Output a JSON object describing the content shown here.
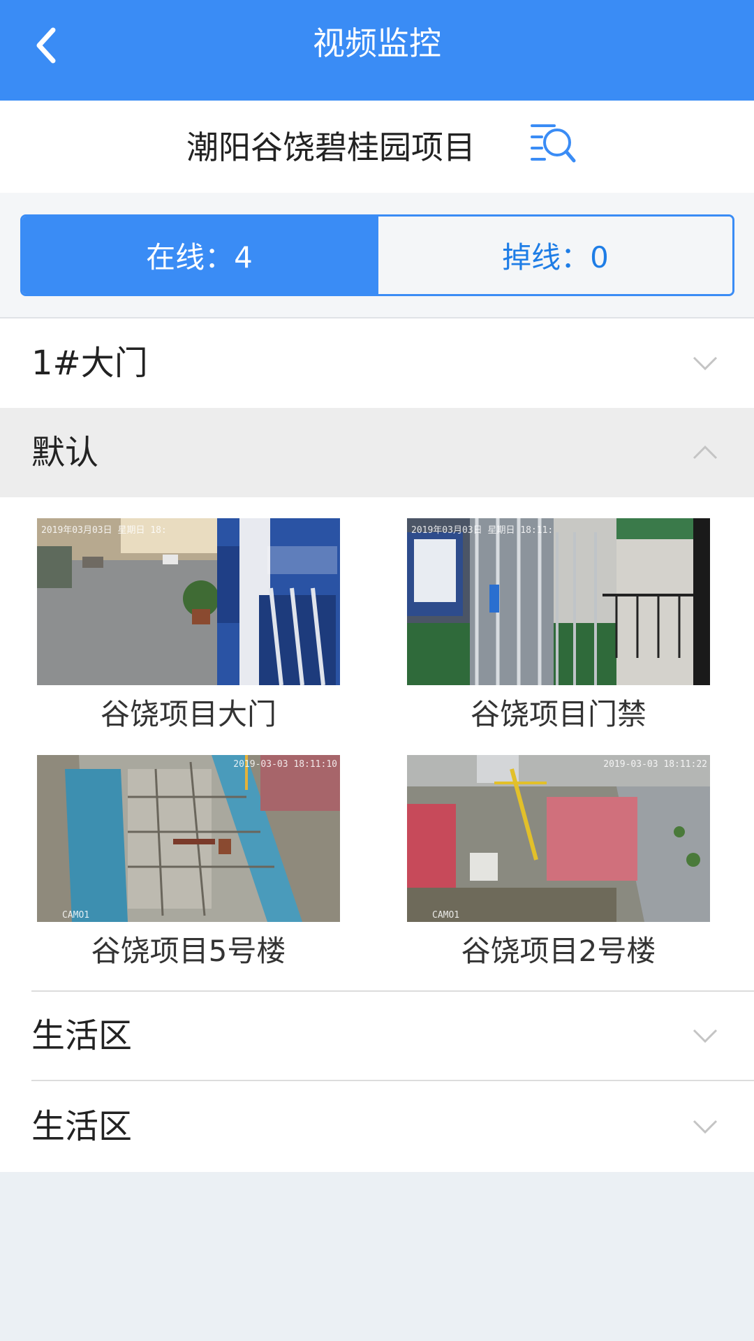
{
  "header": {
    "title": "视频监控"
  },
  "project": {
    "name": "潮阳谷饶碧桂园项目"
  },
  "status": {
    "online_label": "在线：4",
    "offline_label": "掉线：0"
  },
  "groups": [
    {
      "label": "1#大门",
      "expanded": false
    },
    {
      "label": "默认",
      "expanded": true
    },
    {
      "label": "生活区",
      "expanded": false
    },
    {
      "label": "生活区",
      "expanded": false
    }
  ],
  "cameras": [
    {
      "name": "谷饶项目大门",
      "osd": "2019年03月03日 星期日 18:"
    },
    {
      "name": "谷饶项目门禁",
      "osd": "2019年03月03日 星期日 18:11:"
    },
    {
      "name": "谷饶项目5号楼",
      "osd": "2019-03-03 18:11:10",
      "cam": "CAMO1"
    },
    {
      "name": "谷饶项目2号楼",
      "osd": "2019-03-03 18:11:22",
      "cam": "CAMO1"
    }
  ],
  "colors": {
    "primary": "#3a8cf5",
    "offline_text": "#1e7de6",
    "page_bg": "#ebf0f4"
  },
  "icons": {
    "back": "chevron-left-icon",
    "search": "list-search-icon",
    "collapse": "chevron-down-icon",
    "expand": "chevron-up-icon"
  }
}
